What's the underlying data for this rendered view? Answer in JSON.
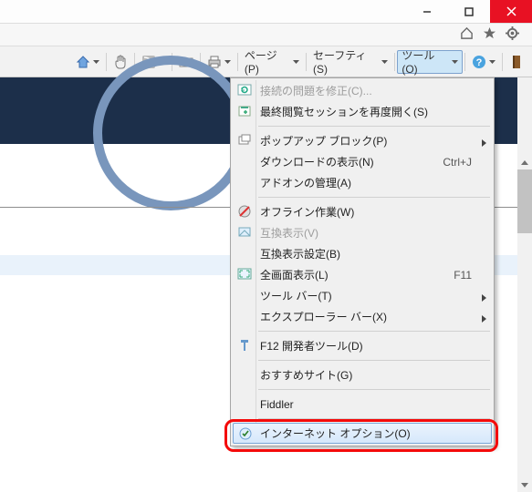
{
  "titlebar": {
    "minimize_tip": "Minimize",
    "maximize_tip": "Maximize",
    "close_tip": "Close"
  },
  "iconrow": {
    "home_tip": "Home",
    "fav_tip": "Favorites",
    "gear_tip": "Tools"
  },
  "toolbar": {
    "page_label": "ページ(P)",
    "safety_label": "セーフティ(S)",
    "tools_label": "ツール(O)"
  },
  "menu": {
    "items": [
      {
        "label": "接続の問題を修正(C)...",
        "disabled": true,
        "icon": "refresh"
      },
      {
        "label": "最終閲覧セッションを再度開く(S)",
        "icon": "reopen"
      },
      {
        "sep": true
      },
      {
        "label": "ポップアップ ブロック(P)",
        "submenu": true,
        "icon": "popup"
      },
      {
        "label": "ダウンロードの表示(N)",
        "shortcut": "Ctrl+J"
      },
      {
        "label": "アドオンの管理(A)"
      },
      {
        "sep": true
      },
      {
        "label": "オフライン作業(W)",
        "icon": "offline"
      },
      {
        "label": "互換表示(V)",
        "disabled": true,
        "icon": "compat"
      },
      {
        "label": "互換表示設定(B)"
      },
      {
        "label": "全画面表示(L)",
        "shortcut": "F11",
        "icon": "fullscreen"
      },
      {
        "label": "ツール バー(T)",
        "submenu": true
      },
      {
        "label": "エクスプローラー バー(X)",
        "submenu": true
      },
      {
        "sep": true
      },
      {
        "label": "F12 開発者ツール(D)",
        "icon": "devtools"
      },
      {
        "sep": true
      },
      {
        "label": "おすすめサイト(G)"
      },
      {
        "sep": true
      },
      {
        "label": "Fiddler"
      },
      {
        "sep": true
      },
      {
        "label": "インターネット オプション(O)",
        "icon": "options",
        "highlight": true
      }
    ]
  }
}
